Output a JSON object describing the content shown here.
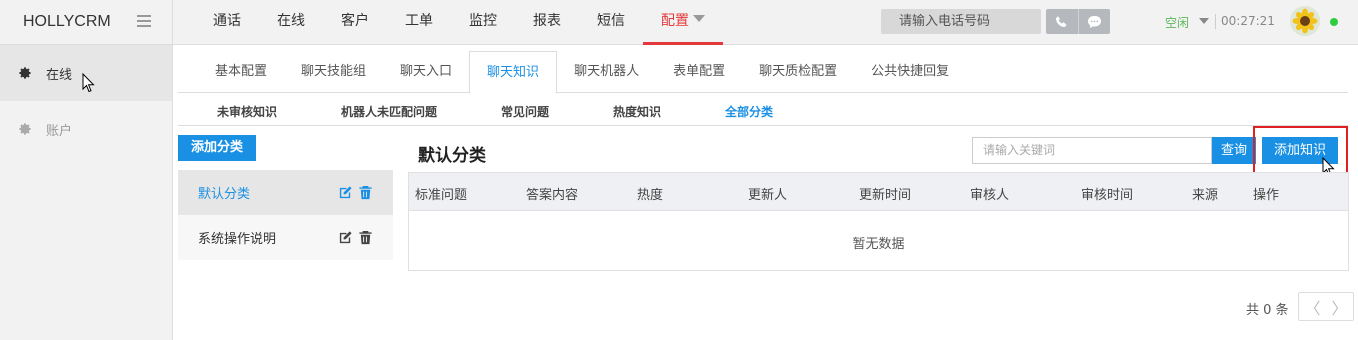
{
  "brand": "HOLLYCRM",
  "sidebar": {
    "items": [
      {
        "label": "在线",
        "icon": "gear-icon",
        "active": true
      },
      {
        "label": "账户",
        "icon": "gear-icon",
        "active": false
      }
    ]
  },
  "topnav": {
    "items": [
      "通话",
      "在线",
      "客户",
      "工单",
      "监控",
      "报表",
      "短信",
      "配置"
    ],
    "active": "配置"
  },
  "topbar": {
    "phone_placeholder": "请输入电话号码",
    "status": "空闲",
    "timer": "00:27:21"
  },
  "main_tabs": {
    "items": [
      "基本配置",
      "聊天技能组",
      "聊天入口",
      "聊天知识",
      "聊天机器人",
      "表单配置",
      "聊天质检配置",
      "公共快捷回复"
    ],
    "active": "聊天知识"
  },
  "sub_tabs": {
    "items": [
      "未审核知识",
      "机器人未匹配问题",
      "常见问题",
      "热度知识",
      "全部分类"
    ],
    "active": "全部分类"
  },
  "categories": {
    "add_label": "添加分类",
    "items": [
      {
        "label": "默认分类",
        "active": true
      },
      {
        "label": "系统操作说明",
        "active": false
      }
    ]
  },
  "content": {
    "title": "默认分类",
    "keyword_placeholder": "请输入关键词",
    "query_label": "查询",
    "add_knowledge_label": "添加知识",
    "columns": [
      "标准问题",
      "答案内容",
      "热度",
      "更新人",
      "更新时间",
      "审核人",
      "审核时间",
      "来源",
      "操作"
    ],
    "empty_text": "暂无数据"
  },
  "pager": {
    "total_text": "共 0 条",
    "prev": "〈",
    "next": "〉"
  },
  "colors": {
    "accent": "#1a90e4",
    "active_nav": "#e4393c",
    "status_green": "#5cb85c"
  }
}
